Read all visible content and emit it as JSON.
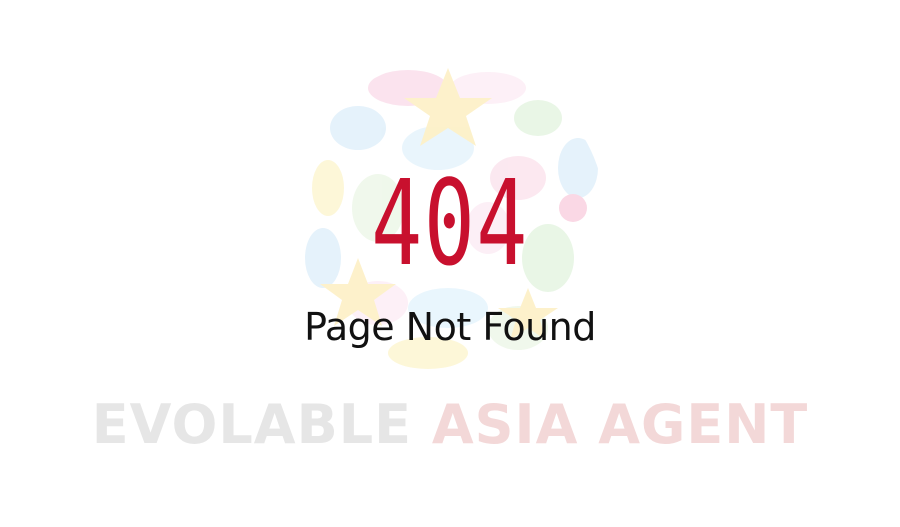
{
  "error": {
    "code": "404",
    "message": "Page Not Found"
  },
  "brand": {
    "part1": "EVOLABLE",
    "part2": "ASIA AGENT"
  },
  "colors": {
    "code": "#c8102e",
    "message": "#111111",
    "brand_part1": "#e6e6e6",
    "brand_part2": "#f3d8d8"
  }
}
